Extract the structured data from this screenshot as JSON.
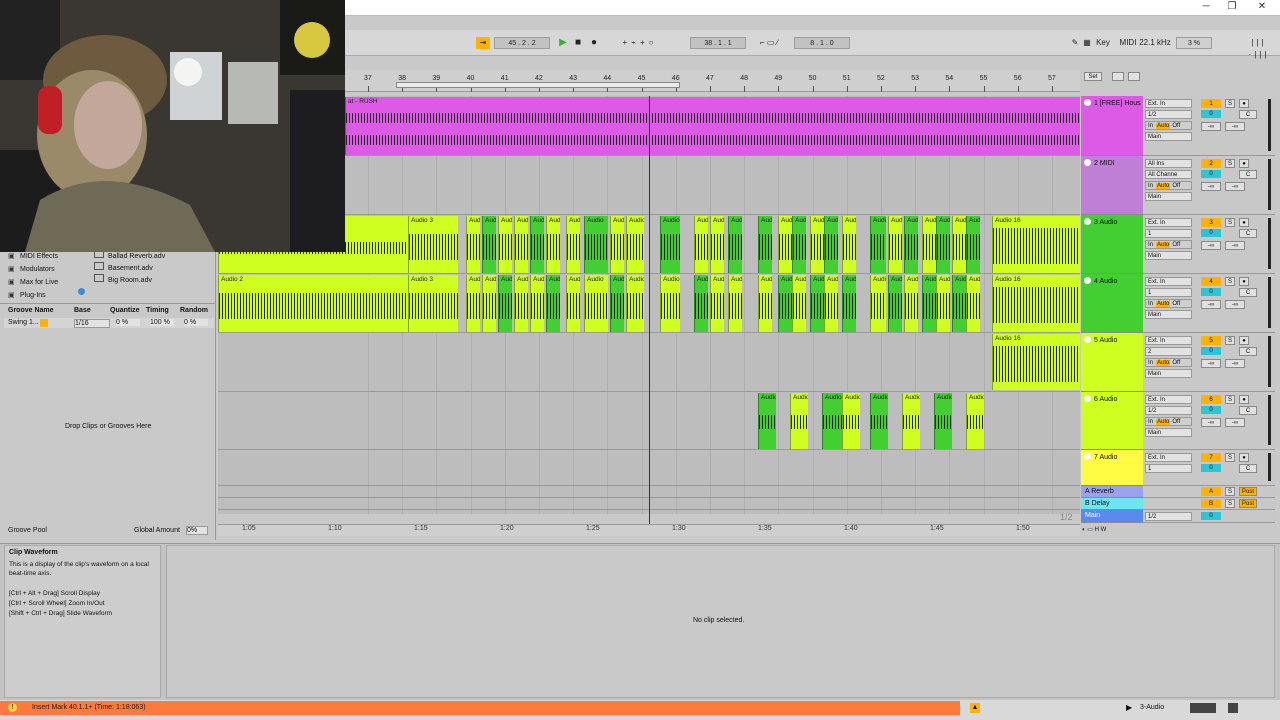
{
  "colors": {
    "magenta": "#dc5ae6",
    "purple_midi": "#c07fd6",
    "lime": "#cfff20",
    "green": "#43cf32",
    "yellow": "#fffb43",
    "orange_status": "#ff7a3c",
    "cyan": "#2ec4d6",
    "playhead": "#333333"
  },
  "window_controls": {
    "minimize": "─",
    "maximize": "❐",
    "close": "✕"
  },
  "transport": {
    "song_position": [
      "45",
      "2",
      "2"
    ],
    "loop_start": [
      "38",
      "1",
      "1"
    ],
    "loop_length": [
      "8",
      "1",
      "0"
    ],
    "key_label": "Key",
    "midi_label": "MIDI",
    "sample_rate": "22.1 kHz",
    "cpu": "3 %"
  },
  "ruler": {
    "bars": [
      "37",
      "38",
      "39",
      "40",
      "41",
      "42",
      "43",
      "44",
      "45",
      "46",
      "47",
      "48",
      "49",
      "50",
      "51",
      "52",
      "53",
      "54",
      "55",
      "56",
      "57"
    ],
    "set_label": "Set"
  },
  "timeline": {
    "labels": [
      "1:05",
      "1:10",
      "1:15",
      "1:20",
      "1:25",
      "1:30",
      "1:35",
      "1:40",
      "1:45",
      "1:50"
    ],
    "page": "1/2"
  },
  "browser": {
    "categories": [
      {
        "label": "MIDI Effects",
        "icon": "midi-effects-icon"
      },
      {
        "label": "Modulators",
        "icon": "modulators-icon"
      },
      {
        "label": "Max for Live",
        "icon": "max-for-live-icon"
      },
      {
        "label": "Plug-Ins",
        "icon": "plugins-icon"
      }
    ],
    "files": [
      "Ballad Reverb.adv",
      "Basement.adv",
      "Big Room.adv"
    ]
  },
  "groove_pool": {
    "columns": [
      "Groove Name",
      "Base",
      "Quantize",
      "Timing",
      "Random"
    ],
    "row": {
      "name": "Swing 1...",
      "base": "1/16",
      "quantize": "0 %",
      "timing": "100 %",
      "random": "0 %"
    },
    "drop_hint": "Drop Clips or Grooves Here",
    "footer_label": "Groove Pool",
    "global_amount_label": "Global Amount",
    "global_amount_value": "0%"
  },
  "info_view": {
    "title": "Clip Waveform",
    "body": "This is a display of the clip's waveform on a local beat-time axis.",
    "shortcuts": [
      "[Ctrl + Alt + Drag] Scroll Display",
      "[Ctrl + Scroll Wheel] Zoom In/Out",
      "[Shift + Ctrl + Drag] Slide Waveform"
    ]
  },
  "clip_view": {
    "empty_message": "No clip selected."
  },
  "status": {
    "message": "Insert Mark 40.1.1+ (Time: 1:18:063)",
    "selected_track": "3-Audio"
  },
  "tracks": [
    {
      "name": "1 [FREE] Hous",
      "number": "1",
      "input": "Ext. In",
      "channel": "1/2",
      "output": "Main",
      "volume": "0",
      "pan": "C",
      "color": "#dc5ae6"
    },
    {
      "name": "2 MIDI",
      "number": "2",
      "input": "All Ins",
      "channel": "All Channe",
      "output": "Main",
      "volume": "0",
      "pan": "C",
      "color": "#c07fd6"
    },
    {
      "name": "3 Audio",
      "number": "3",
      "input": "Ext. In",
      "channel": "1",
      "output": "Main",
      "volume": "0",
      "pan": "C",
      "color": "#43cf32"
    },
    {
      "name": "4 Audio",
      "number": "4",
      "input": "Ext. In",
      "channel": "1",
      "output": "Main",
      "volume": "0",
      "pan": "C",
      "color": "#43cf32"
    },
    {
      "name": "5 Audio",
      "number": "5",
      "input": "Ext. In",
      "channel": "2",
      "output": "Main",
      "volume": "0",
      "pan": "C",
      "color": "#cfff20"
    },
    {
      "name": "6 Audio",
      "number": "6",
      "input": "Ext. In",
      "channel": "1/2",
      "output": "Main",
      "volume": "0",
      "pan": "C",
      "color": "#cfff20"
    },
    {
      "name": "7 Audio",
      "number": "7",
      "input": "Ext. In",
      "channel": "1",
      "output": "Main",
      "volume": "0",
      "pan": "C",
      "color": "#fffb43"
    }
  ],
  "returns": [
    {
      "name": "A Reverb",
      "letter": "A",
      "send_label": "Post"
    },
    {
      "name": "B Delay",
      "letter": "B",
      "send_label": "Post"
    }
  ],
  "master": {
    "name": "Main",
    "channel": "1/2",
    "volume": "0"
  },
  "monitor_labels": {
    "in": "In",
    "auto": "Auto",
    "off": "Off",
    "solo": "S",
    "inf": "-∞"
  },
  "clip_labels": {
    "rush": "at - RUSH",
    "audio3": "Audio 3",
    "audio2": "Audio 2",
    "audio16": "Audio 16",
    "audio": "Audio"
  }
}
